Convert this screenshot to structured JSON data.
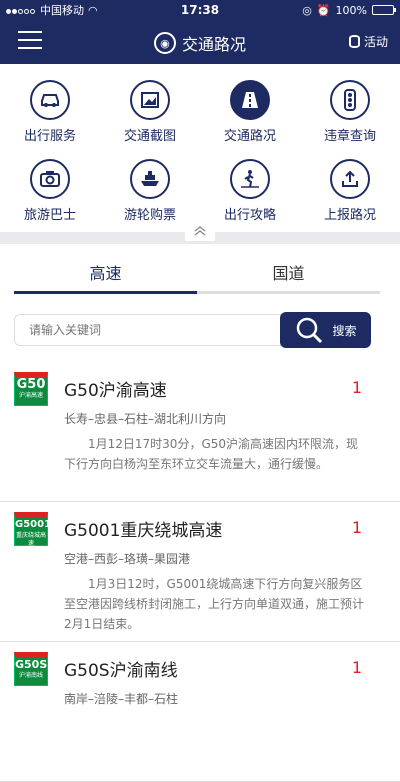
{
  "status_bar": {
    "carrier": "中国移动",
    "time": "17:38",
    "battery": "100%"
  },
  "navbar": {
    "title": "交通路况",
    "right_label": "活动",
    "logo_icon": "traffic-logo-icon",
    "menu_icon": "hamburger-menu-icon"
  },
  "grid": [
    {
      "label": "出行服务",
      "icon": "car-icon"
    },
    {
      "label": "交通截图",
      "icon": "image-icon"
    },
    {
      "label": "交通路况",
      "icon": "road-icon",
      "active": true
    },
    {
      "label": "违章查询",
      "icon": "traffic-light-icon"
    },
    {
      "label": "旅游巴士",
      "icon": "camera-icon"
    },
    {
      "label": "游轮购票",
      "icon": "ship-icon"
    },
    {
      "label": "出行攻略",
      "icon": "map-walk-icon"
    },
    {
      "label": "上报路况",
      "icon": "upload-icon"
    }
  ],
  "tabs": [
    {
      "label": "高速",
      "active": true
    },
    {
      "label": "国道",
      "active": false
    }
  ],
  "search": {
    "placeholder": "请输入关键词",
    "button_label": "搜索"
  },
  "roads": [
    {
      "badge": "G50",
      "badge_sub": "沪渝高速",
      "title": "G50沪渝高速",
      "count": "1",
      "route": "长寿–忠县–石柱–湖北利川方向",
      "desc": "1月12日17时30分，G50沪渝高速因内环限流，现下行方向白杨沟至东环立交车流量大，通行缓慢。"
    },
    {
      "badge": "G5001",
      "badge_sub": "重庆绕城高速",
      "title": "G5001重庆绕城高速",
      "count": "1",
      "route": "空港–西彭–珞璜–果园港",
      "desc": "1月3日12时，G5001绕城高速下行方向复兴服务区至空港因跨线桥封闭施工，上行方向单道双通，施工预计2月1日结束。"
    },
    {
      "badge": "G50S",
      "badge_sub": "沪渝南线",
      "title": "G50S沪渝南线",
      "count": "1",
      "route": "南岸–涪陵–丰都–石柱",
      "desc": ""
    }
  ]
}
